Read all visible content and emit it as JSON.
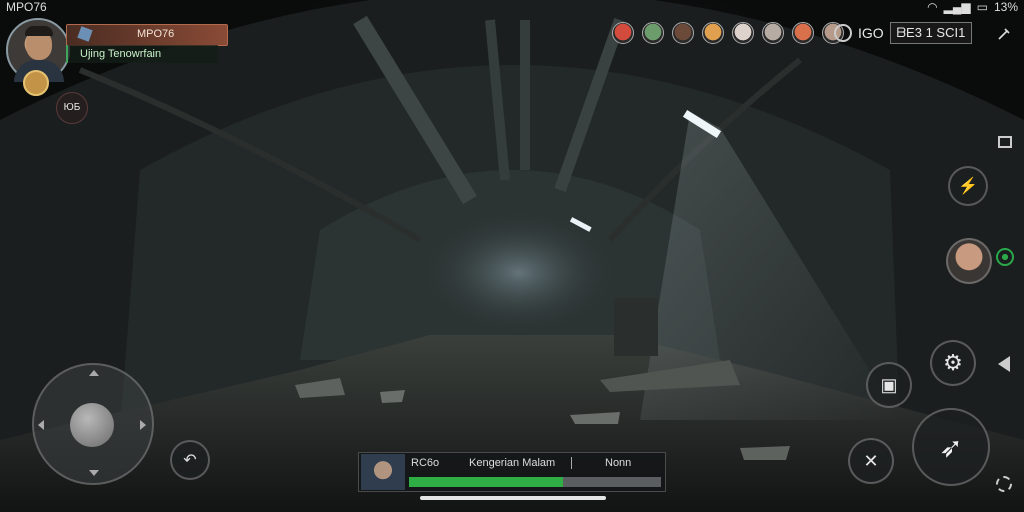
{
  "status_bar": {
    "left_text": "MPO76",
    "battery_text": "13%"
  },
  "player": {
    "name": "MPO76",
    "subtitle": "Ujing Tenowrfain"
  },
  "left_button": {
    "label": "ЮБ"
  },
  "team_faces": [
    {
      "color": "#d24b3c"
    },
    {
      "color": "#6c9c6c"
    },
    {
      "color": "#6b4a3a"
    },
    {
      "color": "#e0a050"
    },
    {
      "color": "#ddd3cc"
    },
    {
      "color": "#b7aca4"
    },
    {
      "color": "#d8704c"
    },
    {
      "color": "#b79b8a"
    }
  ],
  "top_right": {
    "counter_text": "IGO",
    "score_text": "ᗷE3 1 SCI1"
  },
  "bottom_panel": {
    "tag": "RC6o",
    "title": "Kengerian Malam",
    "value": "Nonn",
    "progress_fraction": 0.61,
    "accent_color": "#2fae45"
  },
  "colors": {
    "accent": "#2fae45",
    "name_plate": "#8a4b36"
  }
}
